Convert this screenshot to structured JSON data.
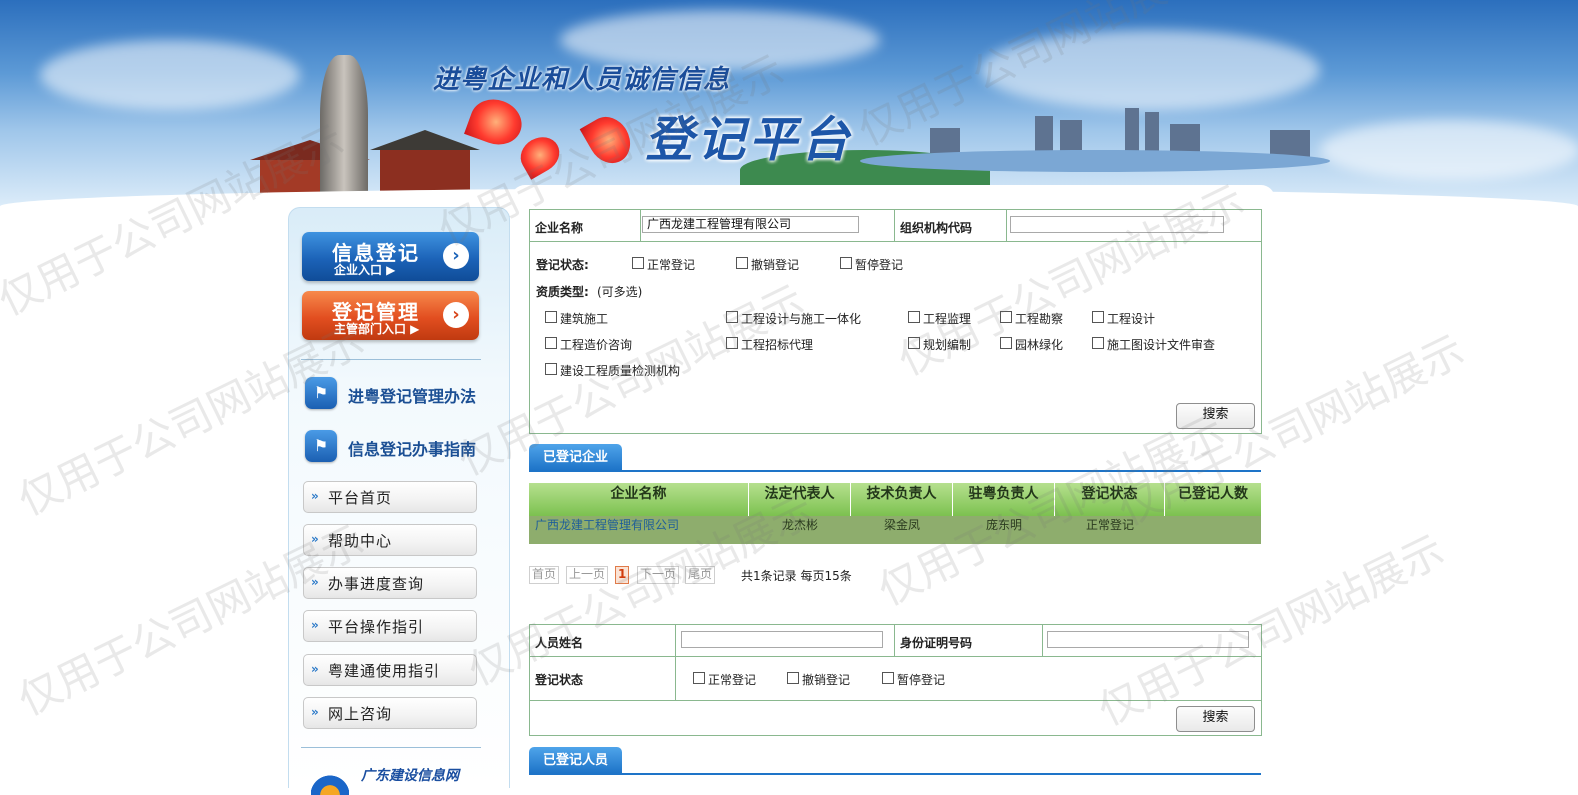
{
  "banner": {
    "title_line1": "进粤企业和人员诚信信息",
    "title_line2": "登记平台"
  },
  "sidebar": {
    "entry_buttons": [
      {
        "label": "信息登记",
        "sub": "企业入口 ▶"
      },
      {
        "label": "登记管理",
        "sub": "主管部门入口 ▶"
      }
    ],
    "flag_links": [
      "进粤登记管理办法",
      "信息登记办事指南"
    ],
    "nav": [
      "平台首页",
      "帮助中心",
      "办事进度查询",
      "平台操作指引",
      "粤建通使用指引",
      "网上咨询"
    ],
    "footer_logo": "广东建设信息网"
  },
  "company_search": {
    "name_label": "企业名称",
    "name_value": "广西龙建工程管理有限公司",
    "org_code_label": "组织机构代码",
    "org_code_value": "",
    "status_label": "登记状态:",
    "status_options": [
      "正常登记",
      "撤销登记",
      "暂停登记"
    ],
    "qual_label": "资质类型:",
    "qual_hint": "(可多选)",
    "qual_options": [
      "建筑施工",
      "工程设计与施工一体化",
      "工程监理",
      "工程勘察",
      "工程设计",
      "工程造价咨询",
      "工程招标代理",
      "规划编制",
      "园林绿化",
      "施工图设计文件审查",
      "建设工程质量检测机构"
    ],
    "search_button": "搜索"
  },
  "company_results": {
    "tab": "已登记企业",
    "columns": [
      "企业名称",
      "法定代表人",
      "技术负责人",
      "驻粤负责人",
      "登记状态",
      "已登记人数"
    ],
    "rows": [
      [
        "广西龙建工程管理有限公司",
        "龙杰彬",
        "梁金凤",
        "庞东明",
        "正常登记",
        ""
      ]
    ],
    "pagination": {
      "first": "首页",
      "prev": "上一页",
      "current": "1",
      "next": "下一页",
      "last": "尾页",
      "summary": "共1条记录 每页15条"
    }
  },
  "person_search": {
    "name_label": "人员姓名",
    "name_value": "",
    "id_label": "身份证明号码",
    "id_value": "",
    "status_label": "登记状态",
    "status_options": [
      "正常登记",
      "撤销登记",
      "暂停登记"
    ],
    "search_button": "搜索",
    "tab": "已登记人员"
  },
  "watermark": "仅用于公司网站展示",
  "colors": {
    "tab_blue": "#1e74c8",
    "table_header_green": "#7cc14f",
    "table_row_green": "#8ead6d",
    "border_green": "#8ab88f"
  }
}
